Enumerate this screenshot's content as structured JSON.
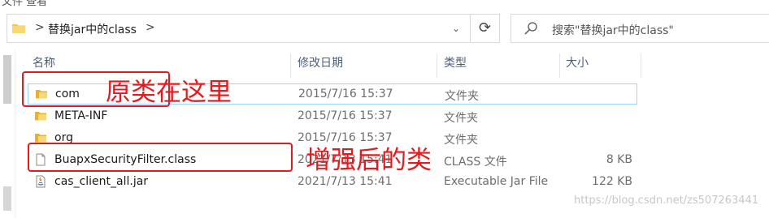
{
  "ribbon": {
    "partial_text": "文件     查看"
  },
  "address_bar": {
    "path": "替换jar中的class",
    "chevron": ">",
    "dropdown": "⌄"
  },
  "refresh": {
    "glyph": "⟳"
  },
  "search": {
    "placeholder": "搜索\"替换jar中的class\""
  },
  "columns": {
    "name": "名称",
    "date": "修改日期",
    "type": "类型",
    "size": "大小"
  },
  "files": [
    {
      "icon": "folder-icon",
      "name": "com",
      "date": "2015/7/16 15:37",
      "type": "文件夹",
      "size": ""
    },
    {
      "icon": "folder-icon",
      "name": "META-INF",
      "date": "2015/7/16 15:37",
      "type": "文件夹",
      "size": ""
    },
    {
      "icon": "folder-icon",
      "name": "org",
      "date": "2015/7/16 15:37",
      "type": "文件夹",
      "size": ""
    },
    {
      "icon": "file-icon",
      "name": "BuapxSecurityFilter.class",
      "date": "2021/7/13 15:41",
      "type": "CLASS 文件",
      "size": "8 KB"
    },
    {
      "icon": "jar-file-icon",
      "name": "cas_client_all.jar",
      "date": "2021/7/13 15:41",
      "type": "Executable Jar File",
      "size": "122 KB"
    }
  ],
  "annotations": {
    "original": "原类在这里",
    "enhanced": "增强后的类"
  },
  "watermark": "https://blog.csdn.net/zs507263441",
  "colors": {
    "annotation": "#e8191e",
    "header_text": "#4c607a",
    "selection_border": "#99d1ff",
    "folder": "#f3c642"
  }
}
